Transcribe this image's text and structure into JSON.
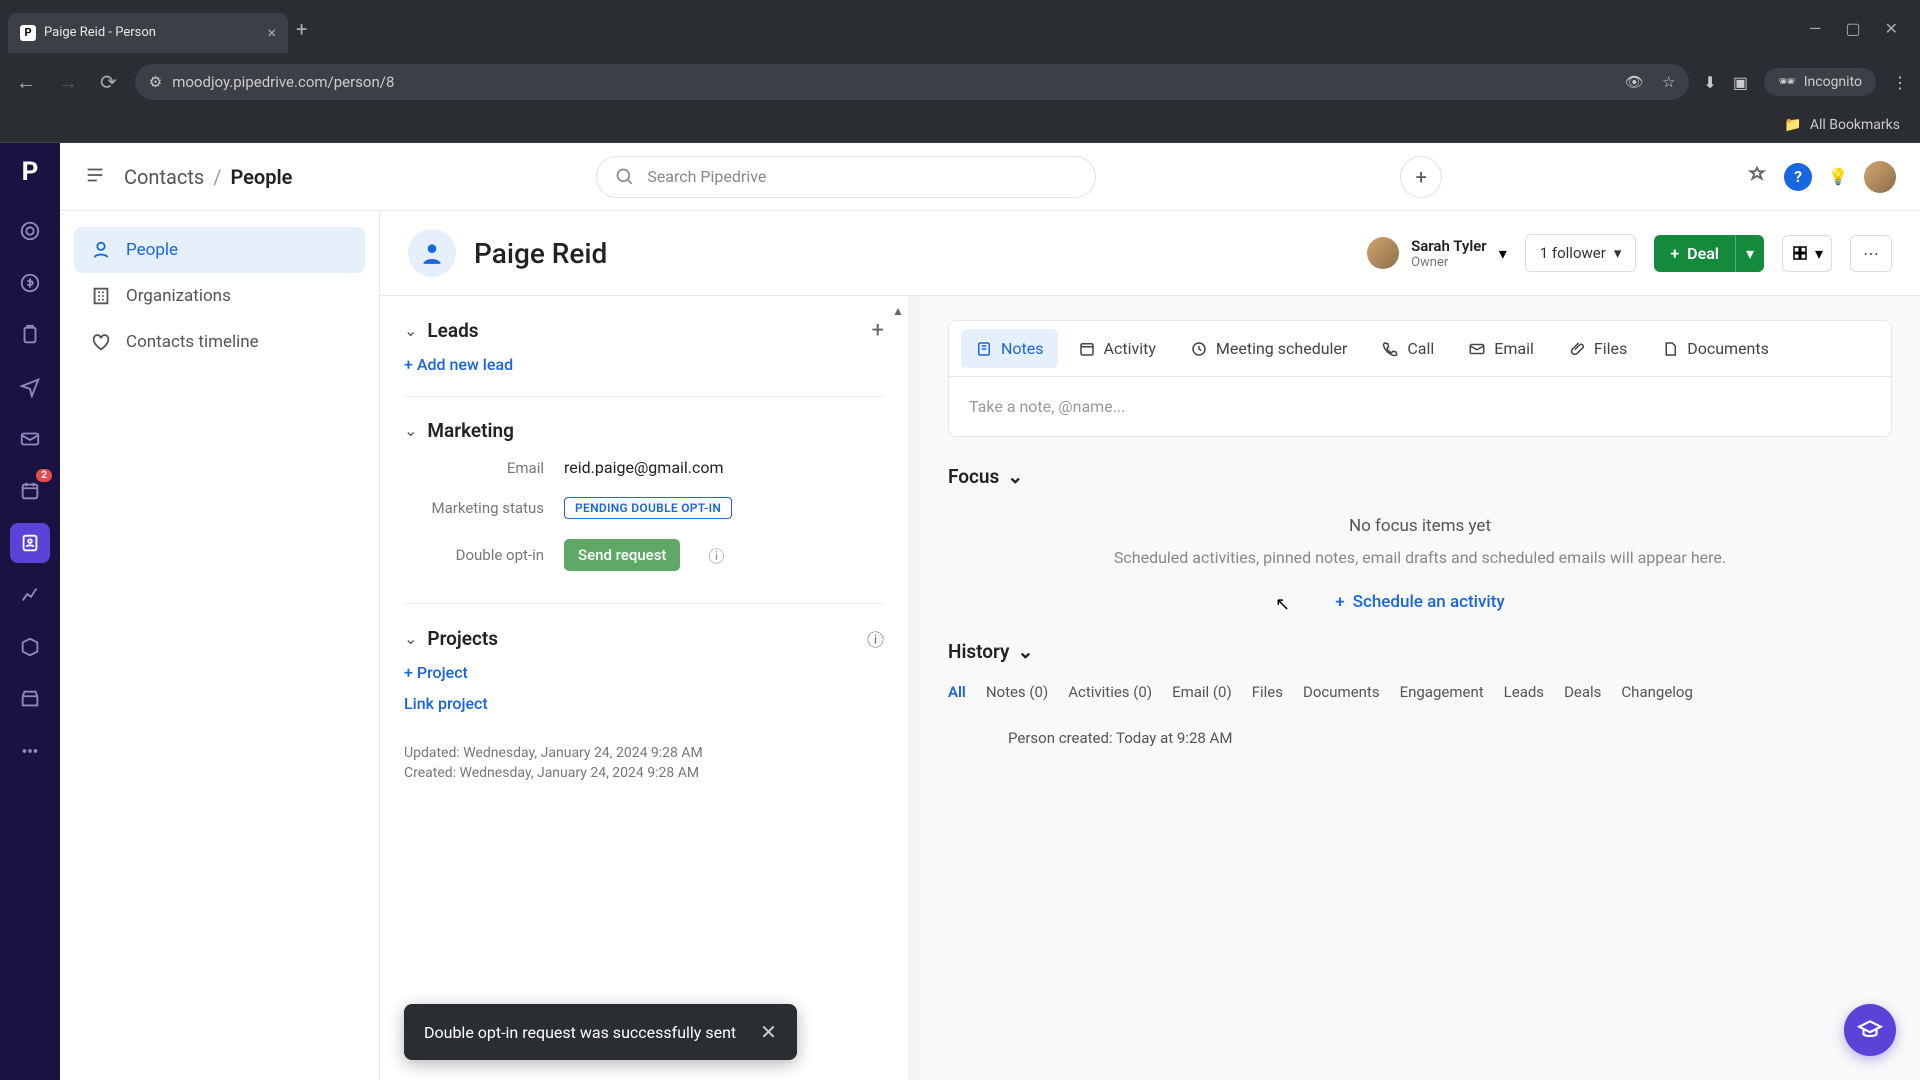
{
  "browser": {
    "tab_title": "Paige Reid - Person",
    "url": "moodjoy.pipedrive.com/person/8",
    "incognito": "Incognito",
    "bookmarks": "All Bookmarks"
  },
  "header": {
    "breadcrumb_parent": "Contacts",
    "breadcrumb_current": "People",
    "search_placeholder": "Search Pipedrive"
  },
  "left_nav": {
    "people": "People",
    "organizations": "Organizations",
    "timeline": "Contacts timeline"
  },
  "person": {
    "name": "Paige Reid",
    "owner_name": "Sarah Tyler",
    "owner_role": "Owner",
    "followers": "1 follower",
    "deal_btn": "Deal"
  },
  "sections": {
    "leads_title": "Leads",
    "add_lead": "+ Add new lead",
    "marketing_title": "Marketing",
    "email_label": "Email",
    "email_value": "reid.paige@gmail.com",
    "status_label": "Marketing status",
    "status_value": "PENDING DOUBLE OPT-IN",
    "optin_label": "Double opt-in",
    "send_request": "Send request",
    "projects_title": "Projects",
    "add_project": "+ Project",
    "link_project": "Link project",
    "updated": "Updated:  Wednesday, January 24, 2024 9:28 AM",
    "created": "Created:  Wednesday, January 24, 2024 9:28 AM"
  },
  "tabs": {
    "notes": "Notes",
    "activity": "Activity",
    "meeting": "Meeting scheduler",
    "call": "Call",
    "email": "Email",
    "files": "Files",
    "documents": "Documents",
    "note_placeholder": "Take a note, @name..."
  },
  "focus": {
    "title": "Focus",
    "empty": "No focus items yet",
    "sub": "Scheduled activities, pinned notes, email drafts and scheduled emails will appear here.",
    "schedule": "Schedule an activity"
  },
  "history": {
    "title": "History",
    "all": "All",
    "notes": "Notes (0)",
    "activities": "Activities (0)",
    "email": "Email (0)",
    "files": "Files",
    "documents": "Documents",
    "engagement": "Engagement",
    "leads": "Leads",
    "deals": "Deals",
    "changelog": "Changelog",
    "item": "Person created:  Today at 9:28 AM"
  },
  "toast": {
    "message": "Double opt-in request was successfully sent"
  },
  "sidebar_badge": "2"
}
